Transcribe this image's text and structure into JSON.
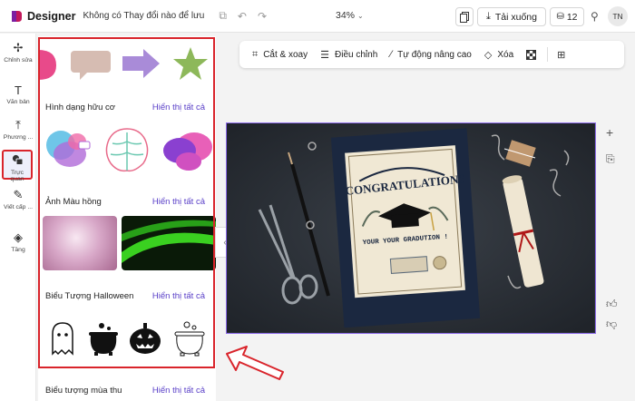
{
  "app": {
    "title": "Designer",
    "status": "Không có Thay đổi nào để lưu"
  },
  "toolbar": {
    "zoom": "34%",
    "download_label": "Tải xuống",
    "credits": "12",
    "avatar_initials": "TN"
  },
  "rail": {
    "items": [
      {
        "label": "Chỉnh sửa",
        "icon": "sparkle-edit-icon"
      },
      {
        "label": "Văn bản",
        "icon": "text-icon"
      },
      {
        "label": "Phương ...",
        "icon": "media-icon"
      },
      {
        "label": "Trực quan",
        "icon": "visual-icon",
        "active": true
      },
      {
        "label": "Viết cấp ...",
        "icon": "pen-icon"
      },
      {
        "label": "Tầng",
        "icon": "layers-icon"
      }
    ]
  },
  "panel": {
    "see_all": "Hiển thị tất cả",
    "sections": [
      {
        "title": "Hình dạng hữu cơ"
      },
      {
        "title": "Ảnh Màu hồng"
      },
      {
        "title": "Biểu Tượng Halloween"
      },
      {
        "title": "Biểu tượng mùa thu"
      }
    ]
  },
  "canvas_toolbar": {
    "crop": "Cắt & xoay",
    "adjust": "Điều chỉnh",
    "auto": "Tự động nâng cao",
    "erase": "Xóa"
  },
  "card": {
    "headline": "CONGRATULATIONS",
    "subline": "YOUR YOUR GRADUTION !"
  },
  "colors": {
    "accent": "#5a40c8",
    "highlight": "#d9242b",
    "canvas_border": "#8b6ae8"
  }
}
